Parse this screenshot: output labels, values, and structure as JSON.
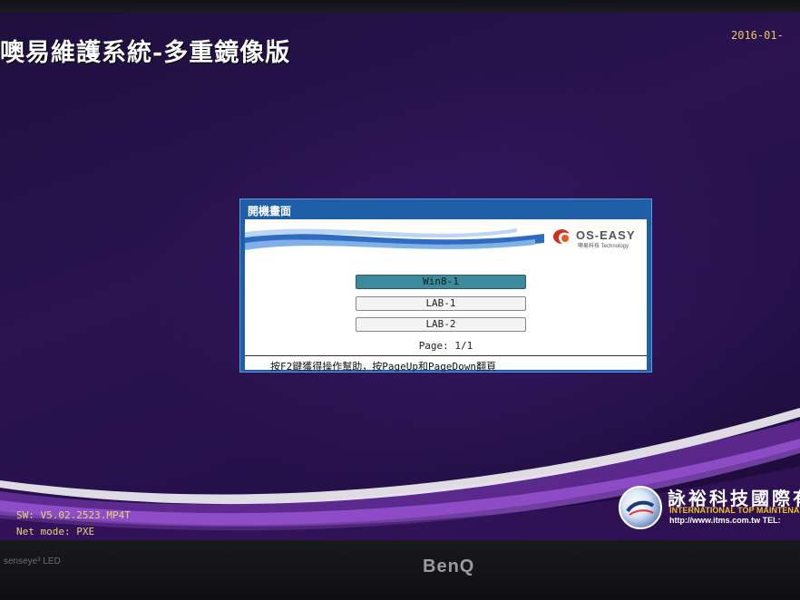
{
  "header": {
    "title": "噢易維護系統-多重鏡像版",
    "date": "2016-01-"
  },
  "dialog": {
    "title": "開機畫面",
    "logo_text": "OS-EASY",
    "logo_sub": "噢易科技 Technology",
    "items": [
      {
        "label": "Win8-1",
        "selected": true
      },
      {
        "label": "LAB-1",
        "selected": false
      },
      {
        "label": "LAB-2",
        "selected": false
      }
    ],
    "page": "Page: 1/1",
    "help": "按F2鍵獲得操作幫助，按PageUp和PageDown翻頁"
  },
  "status": {
    "sw": "SW: V5.02.2523.MP4T",
    "net": "Net mode: PXE"
  },
  "company": {
    "name": "詠裕科技國際有",
    "name_en": "INTERNATIONAL TOP MAINTENAN",
    "url": "http://www.itms.com.tw TEL:"
  },
  "monitor": {
    "senseye": "senseye³  LED",
    "brand": "BenQ"
  },
  "colors": {
    "background": "#26104a",
    "dialog_frame": "#1e5fa8",
    "selected_item": "#3c8a9c",
    "status_text": "#e6d67a",
    "date_text": "#e8c860"
  }
}
